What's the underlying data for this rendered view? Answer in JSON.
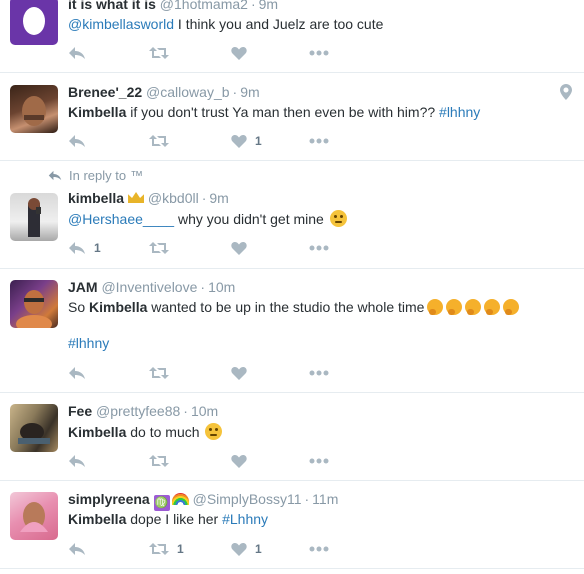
{
  "tweets": [
    {
      "name": "it is what it is",
      "handle": "@1hotmama2",
      "time": "9m",
      "mention": "@kimbellasworld",
      "text": " I think you and Juelz are too cute",
      "retweets": "",
      "likes": ""
    },
    {
      "name": "Brenee'_22",
      "handle": "@calloway_b",
      "time": "9m",
      "bold": "Kimbella",
      "text": " if you don't trust Ya man then even be with him?? ",
      "hashtag": "#lhhny",
      "likes": "1"
    },
    {
      "reply_to": "In reply to",
      "reply_to_mark": "™",
      "name": "kimbella",
      "handle": "@kbd0ll",
      "time": "9m",
      "mention": "@Hershaee____",
      "text": " why you didn't get mine ",
      "replies": "1"
    },
    {
      "name": "JAM",
      "handle": "@Inventivelove",
      "time": "10m",
      "pre": "So ",
      "bold": "Kimbella",
      "text": " wanted to be up in the studio the whole time",
      "hashtag": "#lhhny"
    },
    {
      "name": "Fee",
      "handle": "@prettyfee88",
      "time": "10m",
      "bold": "Kimbella",
      "text": " do to much "
    },
    {
      "name": "simplyreena",
      "virgo": "♍",
      "handle": "@SimplyBossy11",
      "time": "11m",
      "bold": "Kimbella",
      "text": " dope I like her ",
      "hashtag": "#Lhhny",
      "retweets": "1",
      "likes": "1"
    }
  ],
  "separator": "·",
  "colors": {
    "link": "#2b7bb9",
    "icon": "#aab8c2",
    "meta": "#8899a6"
  }
}
